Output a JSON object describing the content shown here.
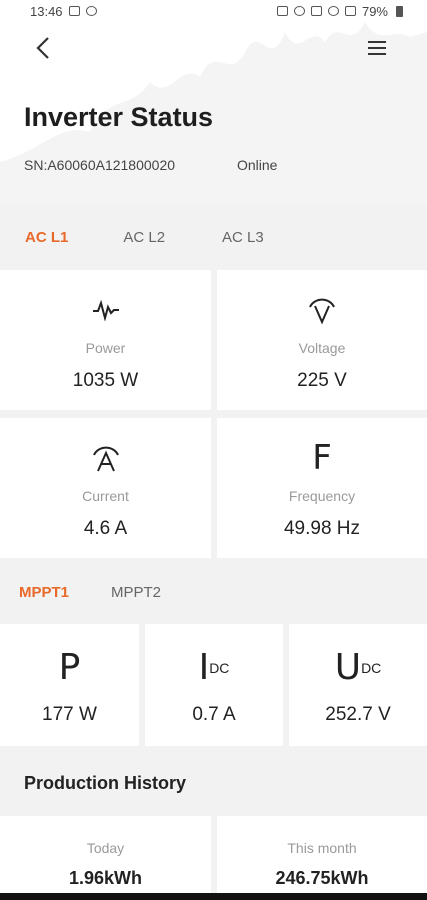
{
  "status_bar": {
    "time": "13:46",
    "battery": "79%"
  },
  "header": {
    "title": "Inverter Status",
    "serial": "SN:A60060A121800020",
    "status": "Online"
  },
  "ac_tabs": [
    "AC L1",
    "AC L2",
    "AC L3"
  ],
  "ac_metrics": [
    {
      "label": "Power",
      "value": "1035 W",
      "icon": "power-wave-icon"
    },
    {
      "label": "Voltage",
      "value": "225 V",
      "icon": "voltage-icon"
    },
    {
      "label": "Current",
      "value": "4.6 A",
      "icon": "current-icon"
    },
    {
      "label": "Frequency",
      "value": "49.98 Hz",
      "icon": "frequency-icon",
      "glyph": "F"
    }
  ],
  "mppt_tabs": [
    "MPPT1",
    "MPPT2"
  ],
  "mppt_metrics": [
    {
      "symbol": "P",
      "sub": "",
      "value": "177 W"
    },
    {
      "symbol": "I",
      "sub": "DC",
      "value": "0.7 A"
    },
    {
      "symbol": "U",
      "sub": "DC",
      "value": "252.7 V"
    }
  ],
  "production": {
    "title": "Production History",
    "items": [
      {
        "label": "Today",
        "value": "1.96kWh"
      },
      {
        "label": "This month",
        "value": "246.75kWh"
      }
    ]
  },
  "colors": {
    "accent": "#e8692a",
    "background": "#f2f2f2",
    "card": "#ffffff"
  }
}
